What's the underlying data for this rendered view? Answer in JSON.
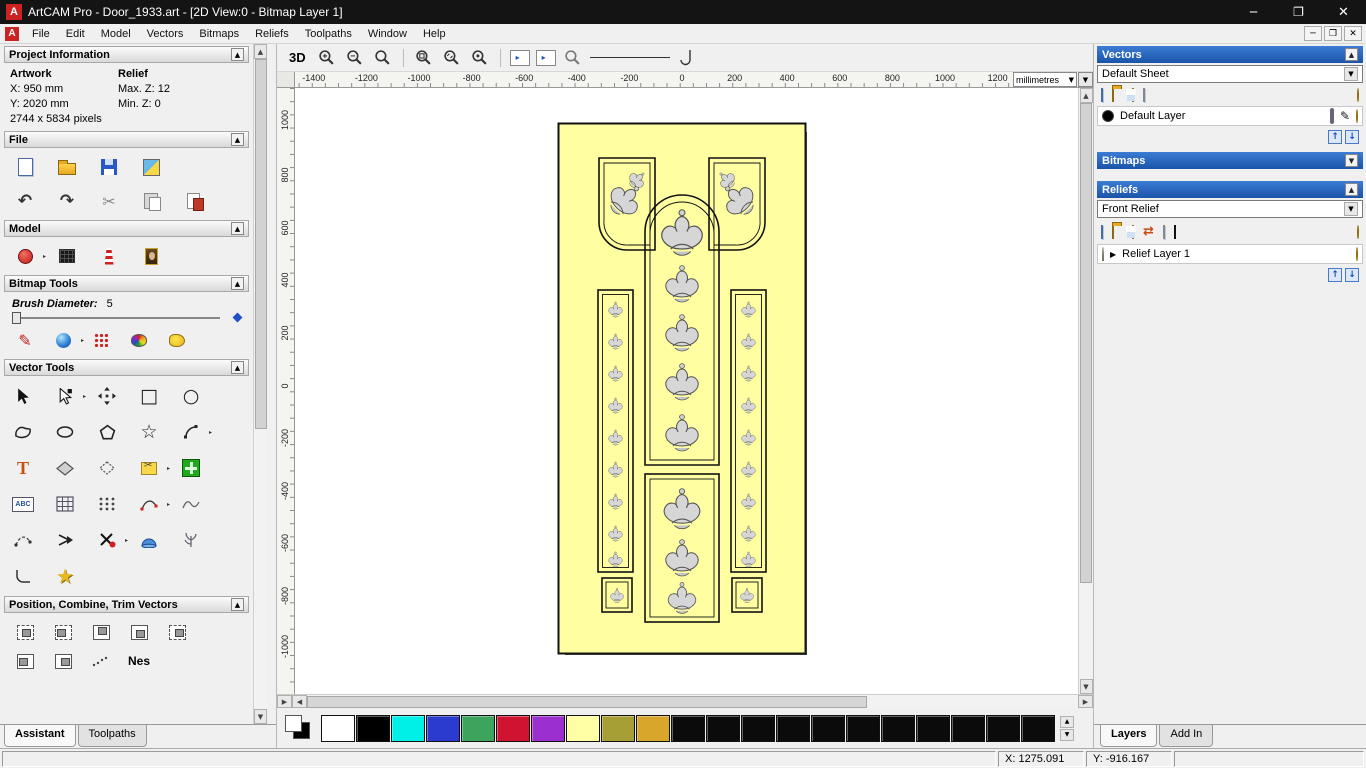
{
  "titlebar": {
    "title": "ArtCAM Pro - Door_1933.art - [2D View:0 - Bitmap Layer 1]",
    "minimize_glyph": "─",
    "maximize_glyph": "❐",
    "close_glyph": "✕"
  },
  "menubar": {
    "items": [
      "File",
      "Edit",
      "Model",
      "Vectors",
      "Bitmaps",
      "Reliefs",
      "Toolpaths",
      "Window",
      "Help"
    ]
  },
  "assistant": {
    "project_info": {
      "header": "Project Information",
      "artwork_label": "Artwork",
      "artwork_x": "X: 950 mm",
      "artwork_y": "Y: 2020 mm",
      "artwork_pixels": "2744 x 5834 pixels",
      "relief_label": "Relief",
      "relief_max_z": "Max. Z: 12",
      "relief_min_z": "Min. Z: 0"
    },
    "file_header": "File",
    "model_header": "Model",
    "bitmap_tools_header": "Bitmap Tools",
    "brush_diameter_label": "Brush Diameter:",
    "brush_diameter_value": "5",
    "vector_tools_header": "Vector Tools",
    "position_header": "Position, Combine, Trim Vectors",
    "nesting_label": "Nes",
    "tabs": [
      {
        "label": "Assistant",
        "active": true
      },
      {
        "label": "Toolpaths",
        "active": false
      }
    ]
  },
  "view_toolbar": {
    "mode_toggle": "3D"
  },
  "rulers": {
    "unit": "millimetres",
    "horizontal": [
      "-1400",
      "-1200",
      "-1000",
      "-800",
      "-600",
      "-400",
      "-200",
      "0",
      "200",
      "400",
      "600",
      "800",
      "1000",
      "1200"
    ],
    "vertical": [
      "1000",
      "800",
      "600",
      "400",
      "200",
      "0",
      "-200",
      "-400",
      "-600",
      "-800",
      "-1000"
    ]
  },
  "right_panel": {
    "vectors": {
      "header": "Vectors",
      "sheet_selector": "Default Sheet",
      "layer_name": "Default Layer",
      "layer_color": "#000000"
    },
    "bitmaps": {
      "header": "Bitmaps"
    },
    "reliefs": {
      "header": "Reliefs",
      "relief_selector": "Front Relief",
      "layer_name": "Relief Layer 1"
    },
    "tabs": [
      {
        "label": "Layers",
        "active": true
      },
      {
        "label": "Add In",
        "active": false
      }
    ]
  },
  "palette": {
    "swatches": [
      "#ffffff",
      "#000000",
      "#00f0e8",
      "#2b3bd0",
      "#3da45e",
      "#d01331",
      "#9c2fd0",
      "#ffffa6",
      "#a59f35",
      "#d8a62b",
      "#0b0b0b",
      "#0b0b0b",
      "#0b0b0b",
      "#0b0b0b",
      "#0b0b0b",
      "#0b0b0b",
      "#0b0b0b",
      "#0b0b0b",
      "#0b0b0b",
      "#0b0b0b",
      "#0b0b0b"
    ]
  },
  "statusbar": {
    "x_coord": "X: 1275.091",
    "y_coord": "Y: -916.167"
  },
  "icons": {
    "undo": "↶",
    "redo": "↷",
    "cut": "✂",
    "pencil": "✎",
    "rect_tool": "□",
    "circle_tool": "○",
    "star_tool": "☆",
    "star_yellow": "★",
    "vector_doctor": "✗",
    "expand_arrow": "▶",
    "up_arrow": "↑",
    "down_arrow": "↓",
    "scroll_up": "▲",
    "scroll_down": "▼",
    "scroll_left": "◀",
    "scroll_right": "▶",
    "swap": "⇄"
  }
}
